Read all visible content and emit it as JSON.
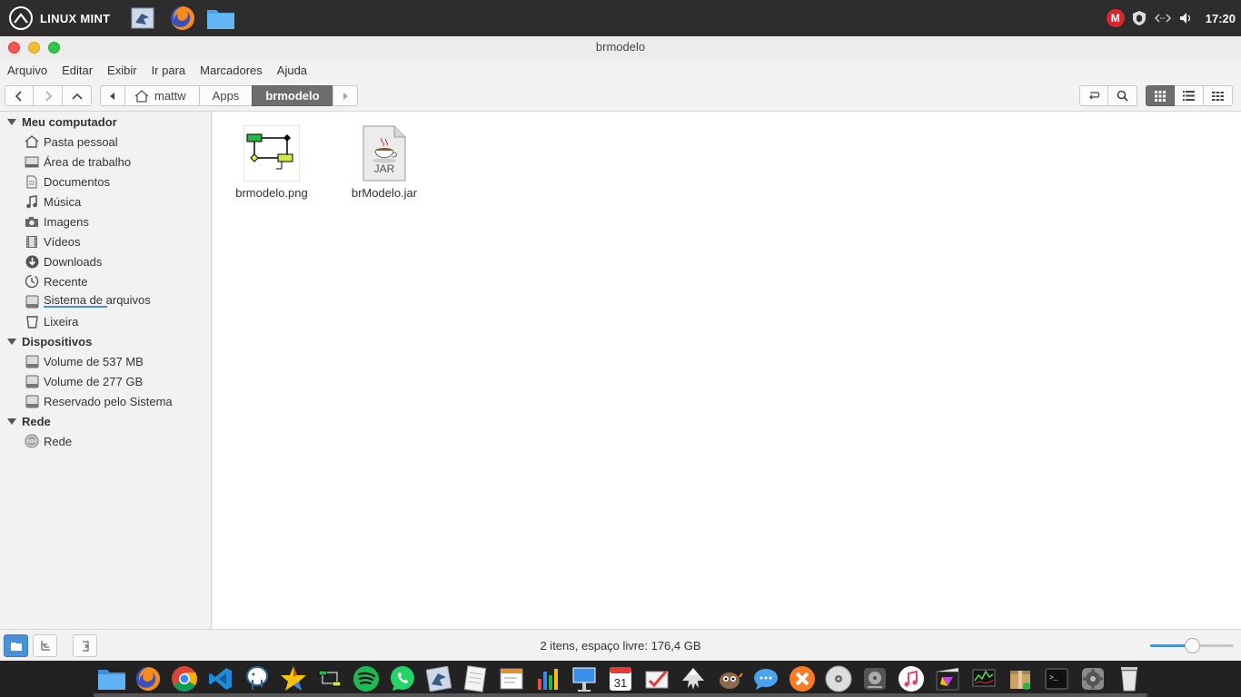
{
  "top_panel": {
    "distro_label": "LINUX MINT",
    "launchers": [
      "bird-app-icon",
      "firefox-icon",
      "files-folder-icon"
    ],
    "tray": [
      "mega-icon",
      "shield-icon",
      "network-icon",
      "volume-icon"
    ],
    "mega_letter": "M",
    "clock": "17:20"
  },
  "window": {
    "title": "brmodelo"
  },
  "menubar": {
    "items": [
      "Arquivo",
      "Editar",
      "Exibir",
      "Ir para",
      "Marcadores",
      "Ajuda"
    ]
  },
  "toolbar": {
    "path": [
      "mattw",
      "Apps",
      "brmodelo"
    ]
  },
  "sidebar": {
    "sections": [
      {
        "title": "Meu computador",
        "items": [
          {
            "label": "Pasta pessoal",
            "icon": "home-icon"
          },
          {
            "label": "Área de trabalho",
            "icon": "desktop-icon"
          },
          {
            "label": "Documentos",
            "icon": "documents-icon"
          },
          {
            "label": "Música",
            "icon": "music-icon"
          },
          {
            "label": "Imagens",
            "icon": "camera-icon"
          },
          {
            "label": "Vídeos",
            "icon": "film-icon"
          },
          {
            "label": "Downloads",
            "icon": "download-icon"
          },
          {
            "label": "Recente",
            "icon": "clock-icon"
          },
          {
            "label": "Sistema de arquivos",
            "icon": "drive-icon"
          },
          {
            "label": "Lixeira",
            "icon": "trash-icon"
          }
        ]
      },
      {
        "title": "Dispositivos",
        "items": [
          {
            "label": "Volume de 537 MB",
            "icon": "drive-icon"
          },
          {
            "label": "Volume de 277 GB",
            "icon": "drive-icon"
          },
          {
            "label": "Reservado pelo Sistema",
            "icon": "drive-icon"
          }
        ]
      },
      {
        "title": "Rede",
        "items": [
          {
            "label": "Rede",
            "icon": "network-icon"
          }
        ]
      }
    ]
  },
  "files": [
    {
      "name": "brmodelo.png",
      "icon": "diagram-image-icon"
    },
    {
      "name": "brModelo.jar",
      "icon": "jar-file-icon",
      "badge": "JAR"
    }
  ],
  "statusbar": {
    "text": "2 itens, espaço livre: 176,4 GB",
    "zoom_level": 0.5
  },
  "dock": {
    "apps": [
      "files-icon",
      "firefox-icon",
      "chrome-icon",
      "vscode-icon",
      "postgresql-icon",
      "star-icon",
      "brmodelo-icon",
      "spotify-icon",
      "whatsapp-icon",
      "bird-app-icon",
      "notes-icon",
      "text-editor-icon",
      "charts-icon",
      "keynote-icon",
      "calendar-icon",
      "mail-check-icon",
      "inkscape-icon",
      "gimp-icon",
      "messages-icon",
      "xampp-icon",
      "disc-icon",
      "disk-utility-icon",
      "music-icon",
      "final-cut-icon",
      "system-monitor-icon",
      "archive-icon",
      "terminal-icon",
      "settings-icon",
      "trash-icon"
    ],
    "calendar_day": "31",
    "terminal_prompt": ">_"
  }
}
